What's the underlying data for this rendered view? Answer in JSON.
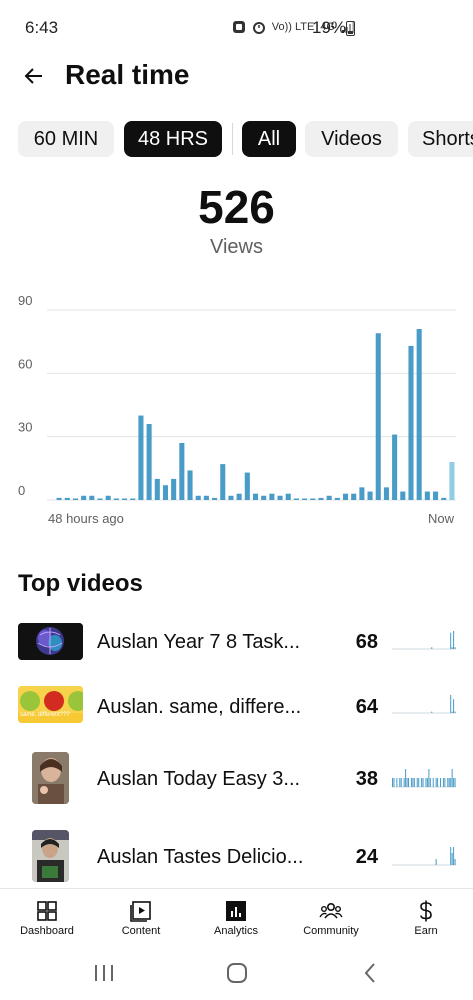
{
  "status_bar": {
    "time": "6:43",
    "network_labels": [
      "Vo)) LTE",
      "4G"
    ],
    "battery": "19%"
  },
  "header": {
    "title": "Real time"
  },
  "chips": [
    {
      "label": "60 MIN",
      "active": false
    },
    {
      "label": "48 HRS",
      "active": true
    },
    {
      "label": "All",
      "active": true
    },
    {
      "label": "Videos",
      "active": false
    },
    {
      "label": "Shorts",
      "active": false
    }
  ],
  "stats": {
    "views_count": "526",
    "views_label": "Views"
  },
  "chart_data": {
    "type": "bar",
    "y_ticks": [
      "90",
      "60",
      "30",
      "0"
    ],
    "ylim": [
      0,
      90
    ],
    "x_start_label": "48 hours ago",
    "x_end_label": "Now",
    "values": [
      1,
      1,
      0,
      2,
      2,
      0,
      2,
      0,
      0,
      0,
      40,
      36,
      10,
      7,
      10,
      27,
      14,
      2,
      2,
      1,
      17,
      2,
      3,
      13,
      3,
      2,
      3,
      2,
      3,
      0,
      0,
      0,
      1,
      2,
      1,
      3,
      3,
      6,
      4,
      79,
      6,
      31,
      4,
      73,
      81,
      4,
      4,
      1,
      18
    ],
    "highlight_last": true,
    "colors": {
      "bar": "#4a9cc8",
      "bar_current": "#8fcde4",
      "grid": "#e3e3e3",
      "axis_text": "#606060"
    }
  },
  "top_videos": {
    "title": "Top videos",
    "items": [
      {
        "title": "Auslan Year 7 8 Task...",
        "views": "68",
        "thumb_kind": "brain",
        "spark": [
          0,
          0,
          0,
          0,
          0,
          0,
          0,
          0,
          0,
          0,
          0,
          0,
          0,
          0,
          0,
          0,
          0,
          0,
          0,
          0,
          0,
          0,
          0,
          0,
          0,
          0,
          0,
          1,
          0,
          0,
          0,
          0,
          0,
          0,
          0,
          0,
          0,
          0,
          0,
          0,
          9,
          1,
          10,
          1
        ]
      },
      {
        "title": "Auslan. same, differe...",
        "views": "64",
        "thumb_kind": "apples",
        "thumb_caption": "same, different???",
        "spark": [
          0,
          0,
          0,
          0,
          0,
          0,
          0,
          0,
          0,
          0,
          0,
          0,
          0,
          0,
          0,
          0,
          0,
          0,
          0,
          0,
          0,
          0,
          0,
          0,
          0,
          0,
          0,
          1,
          0,
          0,
          0,
          0,
          0,
          0,
          0,
          0,
          0,
          0,
          0,
          0,
          13,
          1,
          10,
          1
        ]
      },
      {
        "title": "Auslan Today Easy 3...",
        "views": "38",
        "thumb_kind": "person",
        "spark": [
          1,
          1,
          0,
          1,
          0,
          1,
          1,
          0,
          1,
          2,
          1,
          1,
          0,
          1,
          1,
          1,
          0,
          1,
          1,
          0,
          1,
          1,
          0,
          1,
          1,
          2,
          1,
          0,
          1,
          0,
          1,
          1,
          0,
          1,
          0,
          1,
          1,
          0,
          1,
          1,
          1,
          2,
          1,
          1
        ]
      },
      {
        "title": "Auslan Tastes Delicio...",
        "views": "24",
        "thumb_kind": "person2",
        "spark": [
          0,
          0,
          0,
          0,
          0,
          0,
          0,
          0,
          0,
          0,
          0,
          0,
          0,
          0,
          0,
          0,
          0,
          0,
          0,
          0,
          0,
          0,
          0,
          0,
          0,
          0,
          0,
          0,
          0,
          0,
          1,
          0,
          0,
          0,
          0,
          0,
          0,
          0,
          0,
          0,
          3,
          2,
          3,
          1
        ]
      }
    ]
  },
  "bottom_nav": [
    {
      "label": "Dashboard",
      "icon": "dashboard-icon",
      "active": false
    },
    {
      "label": "Content",
      "icon": "content-icon",
      "active": false
    },
    {
      "label": "Analytics",
      "icon": "analytics-icon",
      "active": true
    },
    {
      "label": "Community",
      "icon": "community-icon",
      "active": false
    },
    {
      "label": "Earn",
      "icon": "earn-icon",
      "active": false
    }
  ]
}
